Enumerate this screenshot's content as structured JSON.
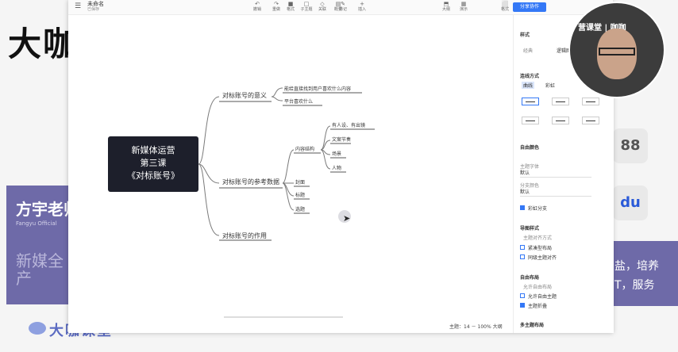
{
  "slide": {
    "title": "大咖",
    "presenter_name": "方宇老师",
    "presenter_sub": "Fangyu Official",
    "left_big_text": "新媒全产",
    "right_text_line1": "盐，培养",
    "right_text_line2": "T，服务",
    "brand": "大咖课堂",
    "right_icon_1": "88",
    "right_icon_2": "du"
  },
  "webcam": {
    "overlay_text": "营课堂 | 咖咖"
  },
  "app": {
    "doc_title": "未命名",
    "doc_subtitle": "已保存",
    "toolbar": [
      {
        "icon": "↶",
        "label": "撤销"
      },
      {
        "icon": "↷",
        "label": "重做"
      },
      {
        "icon": "■",
        "label": "格式"
      },
      {
        "icon": "□",
        "label": "子主题"
      },
      {
        "icon": "◇",
        "label": "关联"
      },
      {
        "icon": "▤",
        "label": "概要"
      },
      {
        "icon": "✎",
        "label": "标记"
      },
      {
        "icon": "+",
        "label": "插入"
      }
    ],
    "right_toolbar": [
      {
        "icon": "⬒",
        "label": "大纲"
      },
      {
        "icon": "▦",
        "label": "演示"
      },
      {
        "icon": "⬜",
        "label": "格式"
      }
    ],
    "share_label": "分享协作"
  },
  "mindmap": {
    "root_line1": "新媒体运营",
    "root_line2": "第三课",
    "root_line3": "《对标账号》",
    "b1": "对标账号的意义",
    "b1_c1": "能给直接找到用户喜欢什么内容",
    "b1_c2": "平台喜欢什么",
    "b2": "对标账号的参考数据",
    "b2_c1": "内容结构",
    "b2_c1_1": "有人设、有出镜",
    "b2_c1_2": "文案节奏",
    "b2_c1_3": "场景",
    "b2_c1_4": "人物",
    "b2_c2": "封面",
    "b2_c3": "标题",
    "b2_c4": "选题",
    "b3": "对标账号的作用"
  },
  "status": {
    "topic_count": "主题：14",
    "zoom": "100%",
    "zoom_out": "－",
    "zoom_in": "大纲"
  },
  "panel": {
    "section_style": "样式",
    "style_opt1": "经典",
    "style_opt2": "逻辑图",
    "section_line": "连线方式",
    "line_opt1": "曲线",
    "line_opt2": "彩虹",
    "section_layout": "自由颜色",
    "field1_label": "主题字体",
    "field1_value": "默认",
    "field2_label": "分支颜色",
    "field2_value": "默认",
    "rainbow_label": "彩虹分支",
    "section_struct": "导图样式",
    "struct_sub": "主题对齐方式",
    "struct_opt1": "紧凑型布局",
    "struct_opt2": "同级主题对齐",
    "section_free": "自由布局",
    "free_sub": "允许自由布局",
    "free_opt1": "允许自由主题",
    "free_opt2": "主题折叠",
    "section_other": "多主题布局"
  },
  "colors": {
    "accent": "#3478f6",
    "root_bg": "#1d1f2b",
    "purple": "#6e6aa8"
  }
}
